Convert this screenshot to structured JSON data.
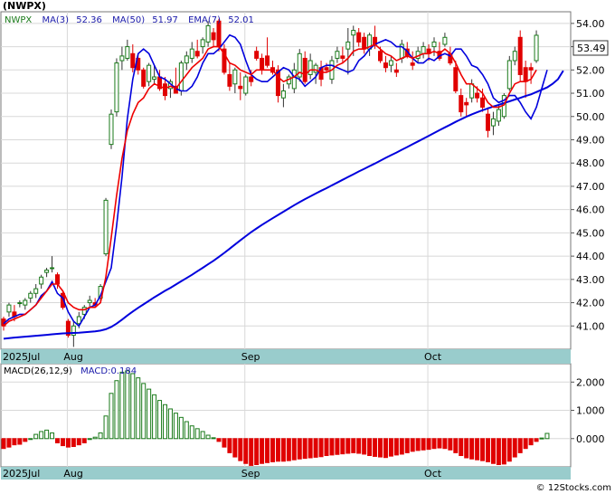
{
  "ticker": "(NWPX)",
  "legend": {
    "symbol": "NWPX",
    "ma3_label": "MA(3)",
    "ma3_value": "52.36",
    "ma50_label": "MA(50)",
    "ma50_value": "51.97",
    "ema7_label": "EMA(7)",
    "ema7_value": "52.01"
  },
  "last_price_label": "53.49",
  "macd_legend": {
    "label": "MACD(26,12,9)",
    "value_label": "MACD:0.184"
  },
  "watermark": "© 12Stocks.com",
  "colors": {
    "up": "#1a7a1a",
    "down": "#e00000",
    "ma": "#0000dd",
    "ema": "#ee0000",
    "axis_bg": "#99cccc"
  },
  "chart_data": [
    {
      "type": "candlestick",
      "title": "(NWPX)",
      "x_labels": [
        "2025Jul",
        "Aug",
        "Sep",
        "Oct"
      ],
      "x_label_index": [
        0,
        12,
        45,
        79
      ],
      "ylim": [
        40.0,
        54.5
      ],
      "y_ticks": [
        41.0,
        42.0,
        43.0,
        44.0,
        45.0,
        46.0,
        47.0,
        48.0,
        49.0,
        50.0,
        51.0,
        52.0,
        53.0,
        54.0
      ],
      "last_price": 53.49,
      "ohlc": [
        [
          41.3,
          41.4,
          40.8,
          41.0
        ],
        [
          41.6,
          42.0,
          41.4,
          41.9
        ],
        [
          41.6,
          41.9,
          41.2,
          41.4
        ],
        [
          42.0,
          42.1,
          41.8,
          42.0
        ],
        [
          41.9,
          42.2,
          41.7,
          42.1
        ],
        [
          42.2,
          42.5,
          42.0,
          42.4
        ],
        [
          42.4,
          42.8,
          42.2,
          42.6
        ],
        [
          42.8,
          43.2,
          42.6,
          43.1
        ],
        [
          43.3,
          43.5,
          43.1,
          43.4
        ],
        [
          43.5,
          44.0,
          43.3,
          43.5
        ],
        [
          43.2,
          43.3,
          42.6,
          42.8
        ],
        [
          42.4,
          42.5,
          41.7,
          41.8
        ],
        [
          41.2,
          41.3,
          40.5,
          40.6
        ],
        [
          40.6,
          41.2,
          40.1,
          41.0
        ],
        [
          41.1,
          41.6,
          40.9,
          41.4
        ],
        [
          41.5,
          41.9,
          41.3,
          41.8
        ],
        [
          42.0,
          42.3,
          41.8,
          42.1
        ],
        [
          42.0,
          42.2,
          41.8,
          41.9
        ],
        [
          42.2,
          42.8,
          42.0,
          42.7
        ],
        [
          44.1,
          46.5,
          44.0,
          46.4
        ],
        [
          48.8,
          50.3,
          48.6,
          50.1
        ],
        [
          50.2,
          52.5,
          50.0,
          52.3
        ],
        [
          52.4,
          53.0,
          52.0,
          52.6
        ],
        [
          52.5,
          53.3,
          52.4,
          53.0
        ],
        [
          52.7,
          53.1,
          51.9,
          52.1
        ],
        [
          52.5,
          52.7,
          51.8,
          52.0
        ],
        [
          52.0,
          52.1,
          51.2,
          51.3
        ],
        [
          51.5,
          52.3,
          51.3,
          52.2
        ],
        [
          51.6,
          52.2,
          51.4,
          51.7
        ],
        [
          51.7,
          52.0,
          51.1,
          51.2
        ],
        [
          51.4,
          51.7,
          50.7,
          50.9
        ],
        [
          51.2,
          51.6,
          50.8,
          51.5
        ],
        [
          51.3,
          52.1,
          51.0,
          51.0
        ],
        [
          51.1,
          52.4,
          50.9,
          52.3
        ],
        [
          52.3,
          52.8,
          52.0,
          52.6
        ],
        [
          52.5,
          53.2,
          52.3,
          52.9
        ],
        [
          52.8,
          53.3,
          52.5,
          52.6
        ],
        [
          53.0,
          53.4,
          52.7,
          53.3
        ],
        [
          53.2,
          54.1,
          53.0,
          53.9
        ],
        [
          53.6,
          53.8,
          53.0,
          53.3
        ],
        [
          54.1,
          54.2,
          52.8,
          53.0
        ],
        [
          52.9,
          53.1,
          51.8,
          51.9
        ],
        [
          51.8,
          52.3,
          51.1,
          51.3
        ],
        [
          51.4,
          52.1,
          51.0,
          52.0
        ],
        [
          51.3,
          51.9,
          50.7,
          51.2
        ],
        [
          51.0,
          51.8,
          50.9,
          51.7
        ],
        [
          51.7,
          52.0,
          51.3,
          51.5
        ],
        [
          52.8,
          53.0,
          52.4,
          52.5
        ],
        [
          52.5,
          52.7,
          51.8,
          52.0
        ],
        [
          52.6,
          53.4,
          52.1,
          52.2
        ],
        [
          52.1,
          52.4,
          51.8,
          51.9
        ],
        [
          52.0,
          52.2,
          50.6,
          50.9
        ],
        [
          50.8,
          51.4,
          50.4,
          51.1
        ],
        [
          51.4,
          51.8,
          51.2,
          51.7
        ],
        [
          51.2,
          52.3,
          51.0,
          52.0
        ],
        [
          51.7,
          52.9,
          51.5,
          52.7
        ],
        [
          52.5,
          52.8,
          51.4,
          51.5
        ],
        [
          51.8,
          52.7,
          51.6,
          52.4
        ],
        [
          51.9,
          52.3,
          51.4,
          52.2
        ],
        [
          52.1,
          52.4,
          51.3,
          51.6
        ],
        [
          52.1,
          52.3,
          51.9,
          52.0
        ],
        [
          51.6,
          52.6,
          51.4,
          52.4
        ],
        [
          52.5,
          53.0,
          52.3,
          52.8
        ],
        [
          52.6,
          53.0,
          52.3,
          52.5
        ],
        [
          52.9,
          53.8,
          51.8,
          53.2
        ],
        [
          53.5,
          53.9,
          52.6,
          53.7
        ],
        [
          53.6,
          53.8,
          53.0,
          53.2
        ],
        [
          53.4,
          53.6,
          52.7,
          52.9
        ],
        [
          52.9,
          53.6,
          52.6,
          53.5
        ],
        [
          53.4,
          53.9,
          52.9,
          53.1
        ],
        [
          52.8,
          53.0,
          52.3,
          52.4
        ],
        [
          52.3,
          52.6,
          51.9,
          52.1
        ],
        [
          52.2,
          52.6,
          51.9,
          52.4
        ],
        [
          52.0,
          52.3,
          51.7,
          51.9
        ],
        [
          52.5,
          53.3,
          52.3,
          53.1
        ],
        [
          52.9,
          53.2,
          52.5,
          52.6
        ],
        [
          52.3,
          52.8,
          52.0,
          52.2
        ],
        [
          52.5,
          53.0,
          52.3,
          52.8
        ],
        [
          52.7,
          53.2,
          52.5,
          53.0
        ],
        [
          52.9,
          53.1,
          52.4,
          52.7
        ],
        [
          53.0,
          53.4,
          52.6,
          53.2
        ],
        [
          52.8,
          53.2,
          52.4,
          52.5
        ],
        [
          53.1,
          53.6,
          53.0,
          53.4
        ],
        [
          52.7,
          53.0,
          52.2,
          52.3
        ],
        [
          52.1,
          52.4,
          51.0,
          51.1
        ],
        [
          50.9,
          51.2,
          50.0,
          50.2
        ],
        [
          50.6,
          50.8,
          50.0,
          50.5
        ],
        [
          50.8,
          51.6,
          50.6,
          51.4
        ],
        [
          51.0,
          51.3,
          50.6,
          50.8
        ],
        [
          50.8,
          51.2,
          50.2,
          50.4
        ],
        [
          50.1,
          50.4,
          49.1,
          49.4
        ],
        [
          49.6,
          50.2,
          49.2,
          49.9
        ],
        [
          49.8,
          50.5,
          49.6,
          50.3
        ],
        [
          50.0,
          51.0,
          49.9,
          50.9
        ],
        [
          51.2,
          52.6,
          51.1,
          52.4
        ],
        [
          52.4,
          53.0,
          52.2,
          52.8
        ],
        [
          53.4,
          53.7,
          51.5,
          51.8
        ],
        [
          52.1,
          52.4,
          50.8,
          51.5
        ],
        [
          52.1,
          52.3,
          51.4,
          52.0
        ],
        [
          52.4,
          53.7,
          52.3,
          53.49
        ]
      ],
      "series": [
        {
          "name": "MA(3)",
          "values": [
            41.1,
            41.3,
            41.4,
            41.5,
            41.5,
            41.7,
            41.9,
            42.3,
            42.5,
            42.9,
            42.4,
            42.2,
            41.6,
            41.2,
            41.0,
            41.4,
            41.8,
            41.9,
            42.3,
            42.9,
            43.5,
            45.3,
            47.4,
            49.9,
            51.6,
            52.7,
            52.9,
            52.7,
            52.2,
            51.7,
            51.6,
            51.4,
            51.2,
            51.1,
            51.1,
            51.3,
            51.7,
            52.3,
            52.7,
            52.7,
            52.9,
            53.2,
            53.5,
            53.4,
            53.1,
            52.4,
            51.8,
            51.6,
            51.5,
            51.5,
            51.7,
            51.9,
            52.1,
            52.0,
            51.7,
            51.6,
            51.3,
            51.5,
            51.7,
            52.1,
            52.2,
            52.2,
            52.1,
            52.0,
            51.9,
            52.0,
            52.4,
            52.6,
            52.9,
            53.1,
            53.2,
            53.3,
            53.2,
            53.0,
            53.0,
            52.8,
            52.5,
            52.3,
            52.3,
            52.5,
            52.4,
            52.6,
            52.7,
            52.6,
            52.9,
            52.9,
            52.6,
            52.2,
            52.1,
            51.8,
            51.4,
            50.8,
            50.6,
            50.7,
            50.9,
            50.9,
            50.6,
            50.2,
            49.9,
            50.4,
            51.2,
            52.0
          ]
        },
        {
          "name": "MA(50)",
          "values": [
            40.45,
            40.48,
            40.5,
            40.52,
            40.54,
            40.56,
            40.58,
            40.6,
            40.62,
            40.64,
            40.66,
            40.68,
            40.69,
            40.7,
            40.71,
            40.73,
            40.75,
            40.77,
            40.8,
            40.86,
            40.96,
            41.1,
            41.27,
            41.45,
            41.62,
            41.78,
            41.93,
            42.08,
            42.23,
            42.37,
            42.51,
            42.64,
            42.78,
            42.92,
            43.06,
            43.2,
            43.35,
            43.5,
            43.65,
            43.8,
            43.97,
            44.14,
            44.32,
            44.5,
            44.68,
            44.86,
            45.03,
            45.19,
            45.34,
            45.49,
            45.63,
            45.77,
            45.91,
            46.05,
            46.19,
            46.32,
            46.45,
            46.57,
            46.69,
            46.81,
            46.92,
            47.04,
            47.16,
            47.28,
            47.4,
            47.52,
            47.64,
            47.75,
            47.87,
            47.98,
            48.1,
            48.22,
            48.34,
            48.45,
            48.57,
            48.69,
            48.81,
            48.93,
            49.05,
            49.17,
            49.29,
            49.41,
            49.53,
            49.65,
            49.77,
            49.88,
            49.99,
            50.09,
            50.18,
            50.27,
            50.35,
            50.43,
            50.5,
            50.58,
            50.65,
            50.73,
            50.8,
            50.88,
            50.95,
            51.05,
            51.15,
            51.25,
            51.4,
            51.6,
            51.97
          ]
        },
        {
          "name": "EMA(7)",
          "values": [
            41.0,
            41.2,
            41.3,
            41.4,
            41.5,
            41.7,
            41.9,
            42.2,
            42.5,
            42.8,
            42.8,
            42.5,
            42.0,
            41.8,
            41.7,
            41.7,
            41.8,
            41.8,
            42.0,
            43.1,
            44.8,
            46.6,
            48.2,
            49.4,
            50.1,
            50.6,
            50.8,
            51.2,
            51.4,
            51.3,
            51.2,
            51.3,
            51.2,
            51.5,
            51.8,
            52.1,
            52.3,
            52.5,
            52.9,
            53.0,
            53.0,
            52.7,
            52.3,
            52.2,
            52.0,
            51.9,
            51.8,
            52.0,
            52.0,
            52.0,
            52.0,
            51.7,
            51.5,
            51.6,
            51.7,
            51.9,
            51.8,
            52.0,
            52.0,
            51.9,
            51.9,
            52.0,
            52.2,
            52.3,
            52.5,
            52.8,
            52.9,
            52.9,
            53.0,
            53.1,
            52.9,
            52.7,
            52.6,
            52.4,
            52.5,
            52.6,
            52.5,
            52.6,
            52.7,
            52.7,
            52.8,
            52.7,
            52.9,
            52.7,
            52.3,
            51.8,
            51.4,
            51.4,
            51.2,
            51.0,
            50.6,
            50.4,
            50.4,
            50.5,
            51.0,
            51.4,
            51.5,
            51.5,
            51.6,
            52.0
          ]
        }
      ]
    },
    {
      "type": "bar",
      "title": "MACD(26,12,9)",
      "ylim": [
        -1.0,
        2.65
      ],
      "y_ticks": [
        0.0,
        1.0,
        2.0
      ],
      "y_tick_labels": [
        "0.000",
        "1.000",
        "2.000"
      ],
      "last_value": 0.184,
      "values": [
        -0.35,
        -0.3,
        -0.22,
        -0.2,
        -0.1,
        0.0,
        0.15,
        0.25,
        0.3,
        0.2,
        -0.15,
        -0.25,
        -0.3,
        -0.28,
        -0.22,
        -0.15,
        0.0,
        0.05,
        0.2,
        0.8,
        1.6,
        2.05,
        2.35,
        2.4,
        2.3,
        2.15,
        1.95,
        1.75,
        1.55,
        1.35,
        1.2,
        1.05,
        0.9,
        0.75,
        0.6,
        0.45,
        0.35,
        0.25,
        0.12,
        0.03,
        -0.1,
        -0.3,
        -0.5,
        -0.65,
        -0.78,
        -0.88,
        -0.95,
        -0.92,
        -0.88,
        -0.85,
        -0.82,
        -0.8,
        -0.8,
        -0.78,
        -0.75,
        -0.72,
        -0.7,
        -0.68,
        -0.66,
        -0.64,
        -0.6,
        -0.58,
        -0.56,
        -0.54,
        -0.52,
        -0.5,
        -0.52,
        -0.55,
        -0.6,
        -0.63,
        -0.65,
        -0.67,
        -0.62,
        -0.58,
        -0.55,
        -0.5,
        -0.45,
        -0.42,
        -0.4,
        -0.38,
        -0.35,
        -0.33,
        -0.35,
        -0.4,
        -0.5,
        -0.6,
        -0.68,
        -0.72,
        -0.75,
        -0.78,
        -0.82,
        -0.88,
        -0.92,
        -0.9,
        -0.8,
        -0.65,
        -0.5,
        -0.35,
        -0.22,
        -0.1,
        0.02,
        0.184
      ]
    }
  ]
}
